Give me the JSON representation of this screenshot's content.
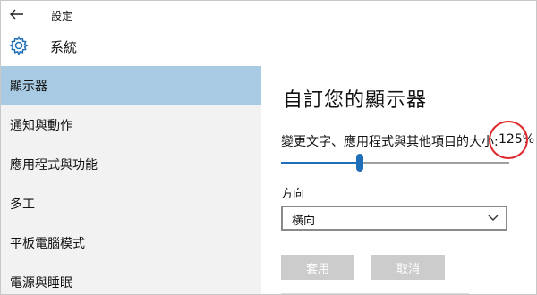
{
  "titlebar": {
    "title": "設定",
    "back_icon": "back-arrow-icon"
  },
  "header": {
    "icon": "gear-icon",
    "title": "系統"
  },
  "sidebar": {
    "items": [
      {
        "label": "顯示器",
        "selected": true
      },
      {
        "label": "通知與動作",
        "selected": false
      },
      {
        "label": "應用程式與功能",
        "selected": false
      },
      {
        "label": "多工",
        "selected": false
      },
      {
        "label": "平板電腦模式",
        "selected": false
      },
      {
        "label": "電源與睡眠",
        "selected": false
      }
    ]
  },
  "main": {
    "title": "自訂您的顯示器",
    "scale_label": "變更文字、應用程式與其他項目的大小:",
    "scale_value": "125%",
    "scale_slider_fraction": 0.34,
    "orientation_label": "方向",
    "orientation_value": "橫向",
    "apply_label": "套用",
    "cancel_label": "取消"
  },
  "colors": {
    "accent": "#1e6fb7",
    "selected_item_bg": "#a8cbe3",
    "annotation_circle": "#e0272b",
    "disabled_button_bg": "#cccccc"
  }
}
